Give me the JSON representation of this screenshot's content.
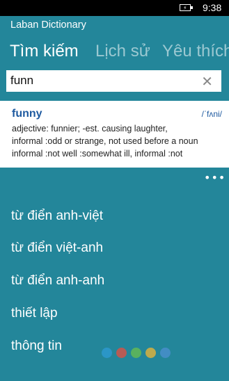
{
  "status_bar": {
    "time": "9:38"
  },
  "app": {
    "title": "Laban Dictionary"
  },
  "pivot": {
    "tabs": [
      "Tìm kiếm",
      "Lịch sử",
      "Yêu thích"
    ]
  },
  "search": {
    "value": "funn"
  },
  "result": {
    "word": "funny",
    "phonetic": "/ˈfʌni/",
    "lines": [
      "adjective: funnier; -est. causing laughter,",
      "informal :odd or strange, not used before a noun",
      "informal :not well :somewhat ill, informal :not"
    ]
  },
  "menu": {
    "more": "•••",
    "items": [
      "từ điển anh-việt",
      "từ điển việt-anh",
      "từ điển anh-anh",
      "thiết lập",
      "thông tin"
    ]
  },
  "colors": {
    "background": "#23869a",
    "accent": "#1e5aa0",
    "watermark_dots": [
      "#2f9bd6",
      "#e84c3d",
      "#6cbf4b",
      "#f2b632",
      "#4e8fd1"
    ]
  }
}
